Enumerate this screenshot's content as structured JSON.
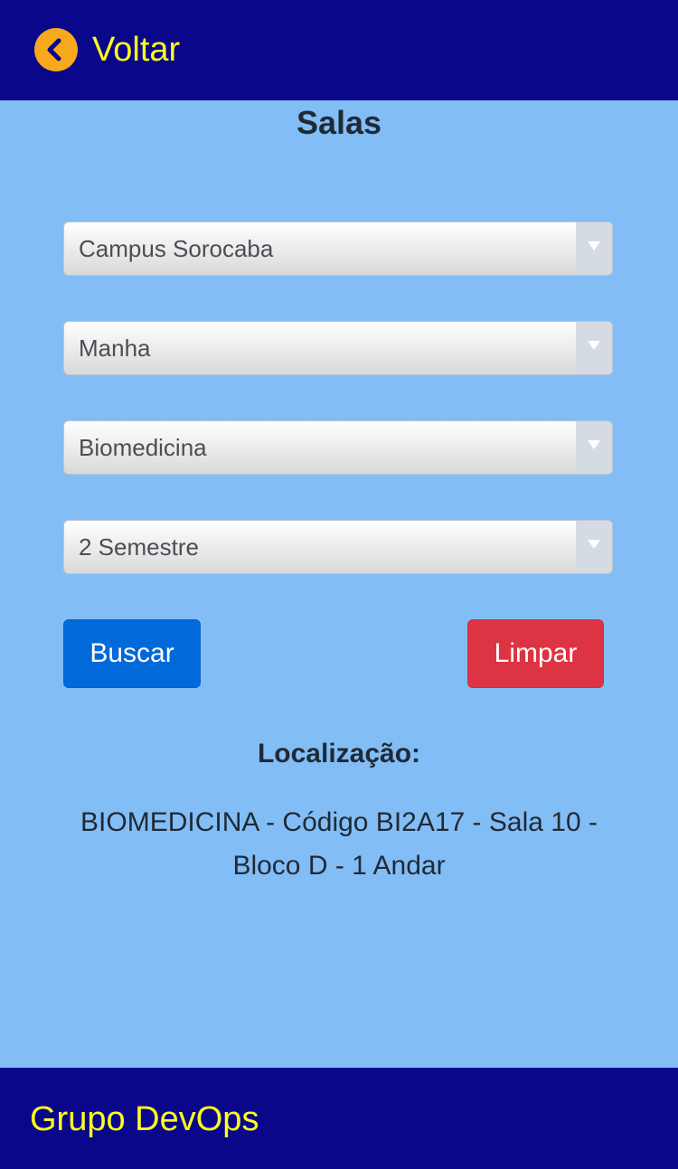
{
  "header": {
    "back_label": "Voltar",
    "icon": "chevron-left-icon",
    "background": "#0a078b",
    "accent": "#ffff1c"
  },
  "page": {
    "title": "Salas"
  },
  "filters": {
    "campus": "Campus Sorocaba",
    "period": "Manha",
    "course": "Biomedicina",
    "semester": "2 Semestre"
  },
  "actions": {
    "search_label": "Buscar",
    "clear_label": "Limpar"
  },
  "result": {
    "heading": "Localização:",
    "text": "BIOMEDICINA - Código BI2A17 - Sala 10 - Bloco D - 1 Andar"
  },
  "footer": {
    "text": "Grupo DevOps"
  }
}
